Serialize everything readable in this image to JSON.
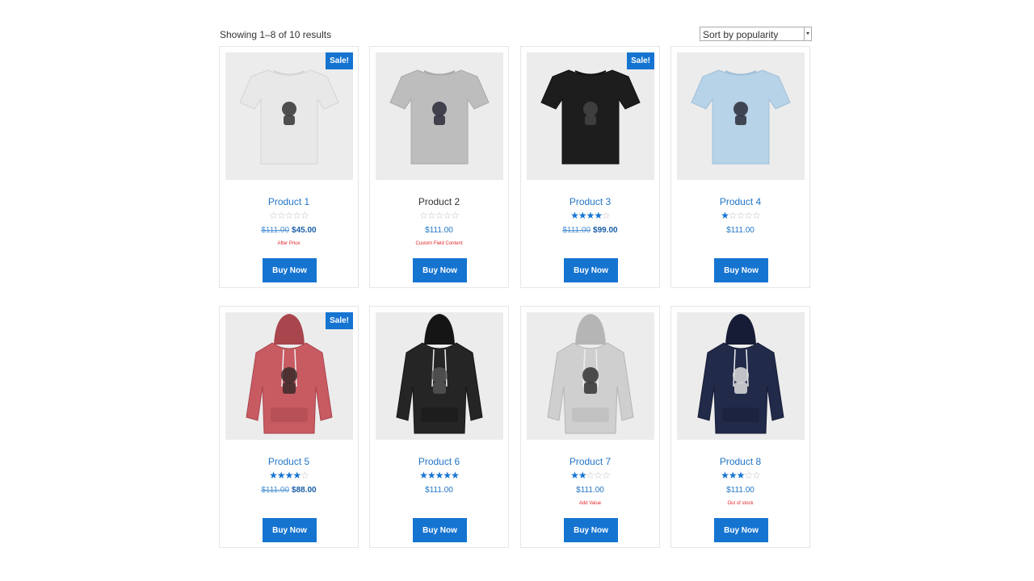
{
  "result_count": "Showing 1–8 of 10 results",
  "sort": {
    "selected": "Sort by popularity"
  },
  "sale_badge": "Sale!",
  "buy_label": "Buy Now",
  "colors": {
    "accent": "#1674d1",
    "note": "#e0262a"
  },
  "products": [
    {
      "title": "Product 1",
      "rating": 0,
      "old_price": "$111.00",
      "price": "$45.00",
      "sale": true,
      "note": "After Price",
      "image": "tshirt-white"
    },
    {
      "title": "Product 2",
      "rating": 0,
      "old_price": "",
      "price": "$111.00",
      "sale": false,
      "note": "Custom Field Content",
      "image": "tshirt-gray"
    },
    {
      "title": "Product 3",
      "rating": 4,
      "old_price": "$111.00",
      "price": "$99.00",
      "sale": true,
      "note": "",
      "image": "tshirt-black"
    },
    {
      "title": "Product 4",
      "rating": 1,
      "old_price": "",
      "price": "$111.00",
      "sale": false,
      "note": "",
      "image": "tshirt-lightblue"
    },
    {
      "title": "Product 5",
      "rating": 4,
      "old_price": "$111.00",
      "price": "$88.00",
      "sale": true,
      "note": "",
      "image": "hoodie-red"
    },
    {
      "title": "Product 6",
      "rating": 5,
      "old_price": "",
      "price": "$111.00",
      "sale": false,
      "note": "",
      "image": "hoodie-black"
    },
    {
      "title": "Product 7",
      "rating": 2,
      "old_price": "",
      "price": "$111.00",
      "sale": false,
      "note": "Add Value",
      "image": "hoodie-gray"
    },
    {
      "title": "Product 8",
      "rating": 3,
      "old_price": "",
      "price": "$111.00",
      "sale": false,
      "note": "Out of stock",
      "image": "hoodie-navy"
    }
  ]
}
